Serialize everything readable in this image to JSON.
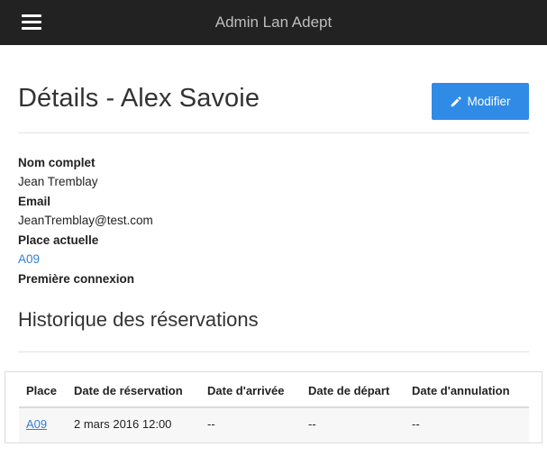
{
  "header": {
    "app_title": "Admin Lan Adept"
  },
  "page": {
    "title": "Détails - Alex Savoie",
    "edit_button_label": "Modifier"
  },
  "details": [
    {
      "label": "Nom complet",
      "value": "Jean Tremblay"
    },
    {
      "label": "Email",
      "value": "JeanTremblay@test.com"
    },
    {
      "label": "Place actuelle",
      "value": "A09"
    },
    {
      "label": "Première connexion",
      "value": ""
    }
  ],
  "history": {
    "title": "Historique des réservations",
    "columns": [
      "Place",
      "Date de réservation",
      "Date d'arrivée",
      "Date de départ",
      "Date d'annulation"
    ],
    "rows": [
      [
        "A09",
        "2 mars 2016 12:00",
        "--",
        "--",
        "--"
      ]
    ]
  },
  "colors": {
    "topbar": "#222222",
    "accent": "#2f8be5",
    "link": "#2f7fd1"
  }
}
